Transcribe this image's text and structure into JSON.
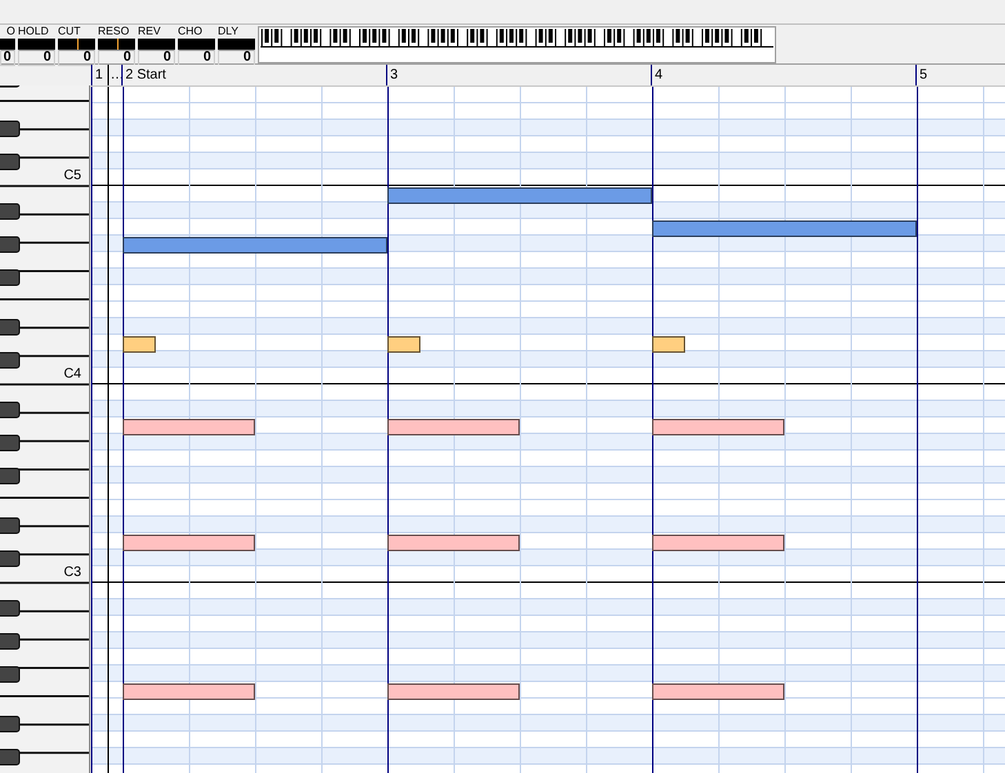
{
  "effects": [
    {
      "label": "O",
      "value": "0"
    },
    {
      "label": "HOLD",
      "value": "0"
    },
    {
      "label": "CUT",
      "value": "0",
      "level": 0.5
    },
    {
      "label": "RESO",
      "value": "0",
      "level": 0.5
    },
    {
      "label": "REV",
      "value": "0"
    },
    {
      "label": "CHO",
      "value": "0"
    },
    {
      "label": "DLY",
      "value": "0"
    }
  ],
  "ruler": [
    {
      "label": "1",
      "kind": "collapsed"
    },
    {
      "label": "…",
      "kind": "ellipsis"
    },
    {
      "label": "2 Start",
      "kind": "measure"
    },
    {
      "label": "3",
      "kind": "measure"
    },
    {
      "label": "4",
      "kind": "measure"
    },
    {
      "label": "5",
      "kind": "measure"
    }
  ],
  "octave_labels": [
    "C5",
    "C4",
    "C3"
  ],
  "notes": [
    {
      "color": "#6b9be6"
    },
    {
      "color": "#6b9be6"
    },
    {
      "color": "#6b9be6"
    },
    {
      "color": "#ffcf80"
    },
    {
      "color": "#ffcf80"
    },
    {
      "color": "#ffcf80"
    },
    {
      "color": "#ffc0c0"
    },
    {
      "color": "#ffc0c0"
    },
    {
      "color": "#ffc0c0"
    },
    {
      "color": "#ffc0c0"
    },
    {
      "color": "#ffc0c0"
    },
    {
      "color": "#ffc0c0"
    },
    {
      "color": "#ffc0c0"
    },
    {
      "color": "#ffc0c0"
    },
    {
      "color": "#ffc0c0"
    }
  ]
}
